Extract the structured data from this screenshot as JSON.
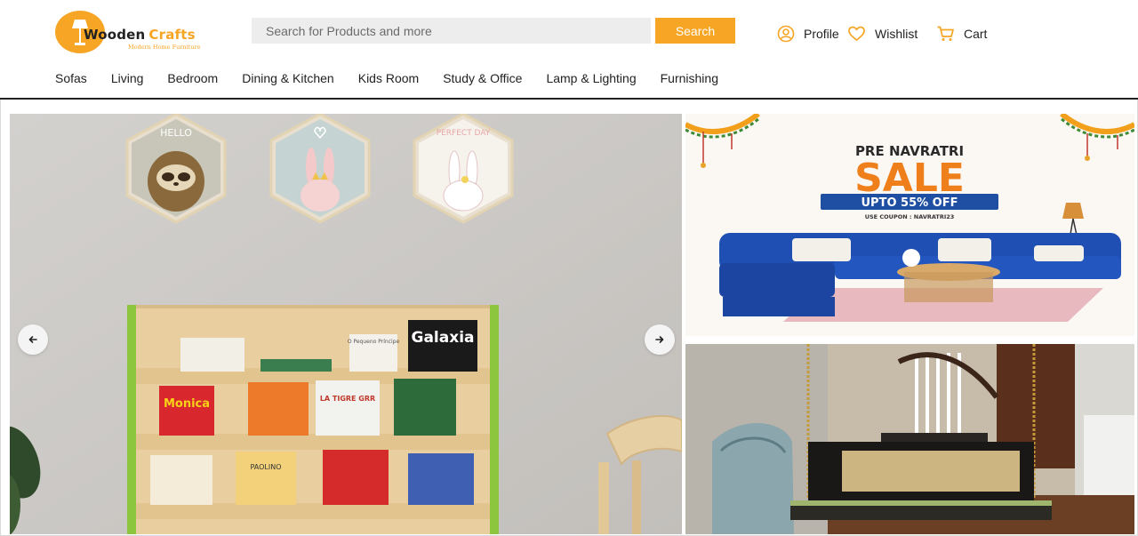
{
  "brand": {
    "name_part1": "Wooden",
    "name_part2": "Crafts",
    "tagline": "Modern Home Furniture",
    "accent_color": "#f6a524"
  },
  "search": {
    "placeholder": "Search for Products and more",
    "button_label": "Search"
  },
  "header_actions": [
    {
      "label": "Profile",
      "icon": "user-circle-icon"
    },
    {
      "label": "Wishlist",
      "icon": "heart-icon"
    },
    {
      "label": "Cart",
      "icon": "cart-icon"
    }
  ],
  "nav": {
    "items": [
      "Sofas",
      "Living",
      "Bedroom",
      "Dining & Kitchen",
      "Kids Room",
      "Study & Office",
      "Lamp & Lighting",
      "Furnishing"
    ]
  },
  "hero": {
    "wall_art": [
      "HELLO",
      "PERFECT DAY"
    ],
    "book_titles": [
      "Galaxia",
      "O Pequeno Príncipe",
      "Monica",
      "LA TIGRE GRR",
      "PAOLINO"
    ]
  },
  "promo_top": {
    "line1": "PRE NAVRATRI",
    "line2": "SALE",
    "offer": "UPTO 55% OFF",
    "coupon": "USE COUPON : NAVRATRI23"
  },
  "carousel": {
    "prev_icon": "arrow-left-icon",
    "next_icon": "arrow-right-icon"
  }
}
